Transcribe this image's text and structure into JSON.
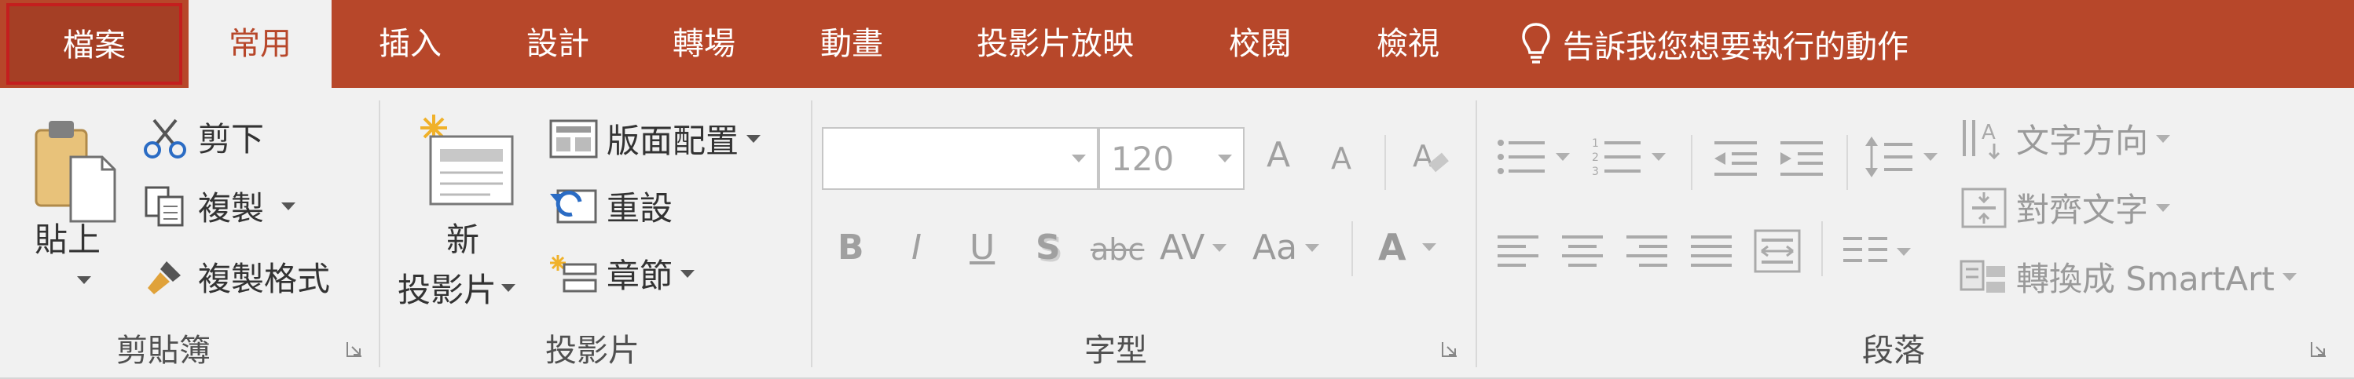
{
  "tabs": {
    "file": "檔案",
    "home": "常用",
    "insert": "插入",
    "design": "設計",
    "transitions": "轉場",
    "animations": "動畫",
    "slideshow": "投影片放映",
    "review": "校閱",
    "view": "檢視",
    "tell_me": "告訴我您想要執行的動作"
  },
  "clipboard": {
    "group_label": "剪貼簿",
    "paste_line1": "貼上",
    "cut": "剪下",
    "copy": "複製",
    "format_painter": "複製格式"
  },
  "slides": {
    "group_label": "投影片",
    "new_slide_line1": "新",
    "new_slide_line2": "投影片",
    "layout": "版面配置",
    "reset": "重設",
    "section": "章節"
  },
  "font": {
    "group_label": "字型",
    "font_name": "",
    "font_size": "120",
    "grow": "A",
    "shrink": "A",
    "bold": "B",
    "italic": "I",
    "underline": "U",
    "shadow": "S",
    "strike": "abc",
    "spacing": "AV",
    "change_case": "Aa",
    "font_color": "A"
  },
  "paragraph": {
    "group_label": "段落",
    "text_direction": "文字方向",
    "align_text": "對齊文字",
    "smartart": "轉換成 SmartArt"
  },
  "colors": {
    "accent": "#b7472a",
    "file_outline": "#c41e1e",
    "ribbon_bg": "#f1f1f1"
  }
}
